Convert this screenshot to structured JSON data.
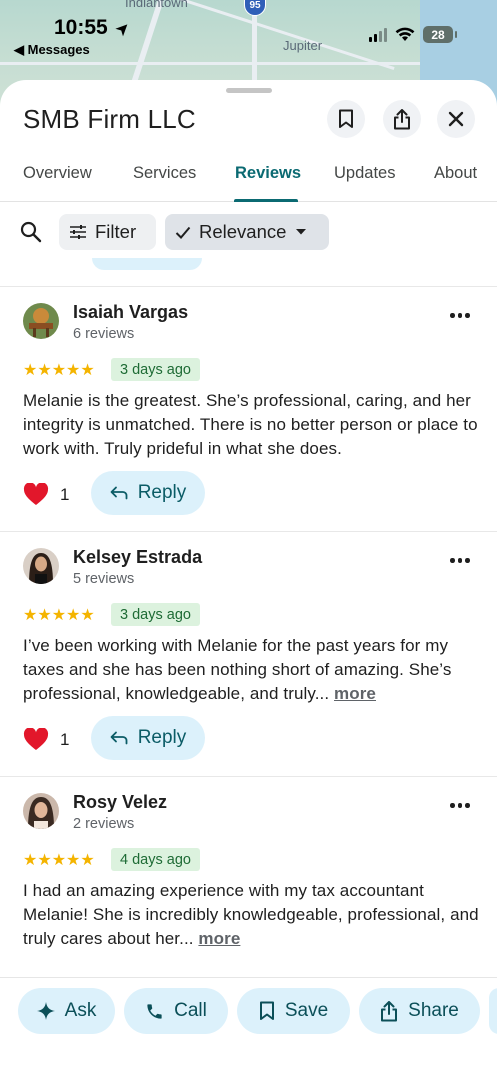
{
  "status_bar": {
    "time": "10:55",
    "location_arrow": "➤",
    "back_label": "◀ Messages",
    "battery": "28"
  },
  "map": {
    "labels": [
      "Indiantown",
      "Jupiter"
    ],
    "highway": "95"
  },
  "place": {
    "title": "SMB Firm LLC"
  },
  "tabs": [
    {
      "label": "Overview",
      "active": false
    },
    {
      "label": "Services",
      "active": false
    },
    {
      "label": "Reviews",
      "active": true
    },
    {
      "label": "Updates",
      "active": false
    },
    {
      "label": "About",
      "active": false
    }
  ],
  "toolbar": {
    "filter_label": "Filter",
    "sort_label": "Relevance"
  },
  "reviews": [
    {
      "name": "Isaiah Vargas",
      "review_count": "6 reviews",
      "stars": "★★★★★",
      "when": "3 days ago",
      "text": "Melanie is the greatest. She’s professional, caring, and her integrity is unmatched. There is no better person or place to work with. Truly prideful in what she does.",
      "more": "",
      "likes": "1",
      "reply_label": "Reply"
    },
    {
      "name": "Kelsey Estrada",
      "review_count": "5 reviews",
      "stars": "★★★★★",
      "when": "3 days ago",
      "text": "I’ve been working with Melanie for the past years for my taxes and she has been nothing short of amazing. She’s professional, knowledgeable, and truly... ",
      "more": "more",
      "likes": "1",
      "reply_label": "Reply"
    },
    {
      "name": "Rosy Velez",
      "review_count": "2 reviews",
      "stars": "★★★★★",
      "when": "4 days ago",
      "text": "I had an amazing experience with my tax accountant Melanie! She is incredibly knowledgeable, professional, and truly cares about her... ",
      "more": "more",
      "likes": "",
      "reply_label": ""
    }
  ],
  "actions": {
    "ask": "Ask",
    "call": "Call",
    "save": "Save",
    "share": "Share"
  },
  "colors": {
    "accent": "#0b6a72",
    "pill_bg": "#dcf1fb",
    "star": "#f4b400",
    "date_bg": "#dcf2de",
    "heart": "#e2172b"
  }
}
